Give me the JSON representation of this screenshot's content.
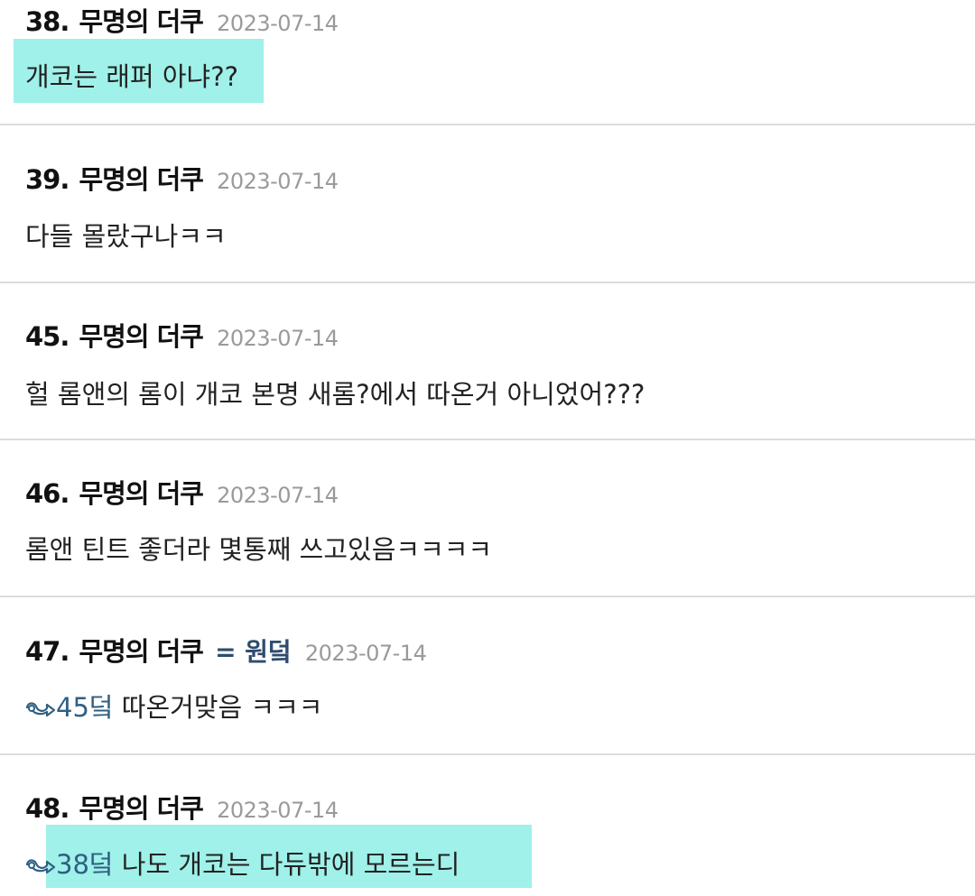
{
  "comments": [
    {
      "number": "38.",
      "author": "무명의 더쿠",
      "date": "2023-07-14",
      "text": "개코는 래퍼 아냐??"
    },
    {
      "number": "39.",
      "author": "무명의 더쿠",
      "date": "2023-07-14",
      "text": "다들 몰랐구나ㅋㅋ"
    },
    {
      "number": "45.",
      "author": "무명의 더쿠",
      "date": "2023-07-14",
      "text": "헐 롬앤의 롬이 개코 본명 새롬?에서 따온거 아니었어???"
    },
    {
      "number": "46.",
      "author": "무명의 더쿠",
      "date": "2023-07-14",
      "text": "롬앤 틴트 좋더라 몇통째 쓰고있음ㅋㅋㅋㅋ"
    },
    {
      "number": "47.",
      "author": "무명의 더쿠",
      "op_tag": "= 원덬",
      "date": "2023-07-14",
      "reply_ref": "45덬",
      "text": " 따온거맞음 ㅋㅋㅋ"
    },
    {
      "number": "48.",
      "author": "무명의 더쿠",
      "date": "2023-07-14",
      "reply_ref": "38덬",
      "text": " 나도 개코는 다듀밖에 모르는디"
    }
  ],
  "colors": {
    "highlight": "#9ff1e9",
    "op_tag": "#2f4c6e",
    "reply_ref": "#2f5f82",
    "date": "#9a9a9a",
    "divider": "#dcdcdc"
  },
  "icons": {
    "reply": "reply-arrow-icon"
  }
}
